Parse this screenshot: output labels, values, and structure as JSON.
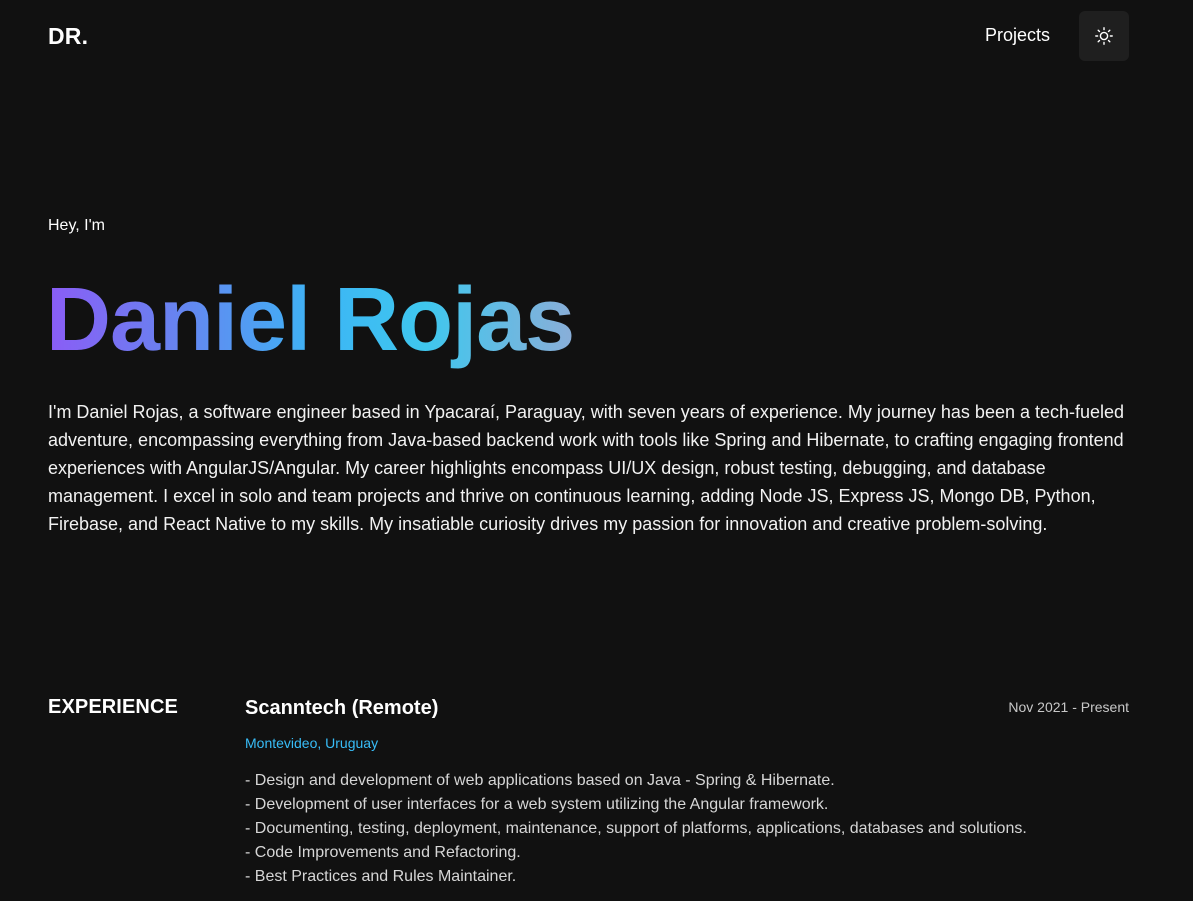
{
  "header": {
    "logo": "DR.",
    "nav_projects": "Projects",
    "theme_toggle_icon": "sun-icon"
  },
  "hero": {
    "greeting": "Hey, I'm",
    "name": "Daniel Rojas",
    "name_gradient": [
      "#8b5cf6",
      "#3cb5f5",
      "#8aaed8"
    ],
    "bio": "I'm Daniel Rojas, a software engineer based in Ypacaraí, Paraguay, with seven years of experience. My journey has been a tech-fueled adventure, encompassing everything from Java-based backend work with tools like Spring and Hibernate, to crafting engaging frontend experiences with AngularJS/Angular. My career highlights encompass UI/UX design, robust testing, debugging, and database management. I excel in solo and team projects and thrive on continuous learning, adding Node JS, Express JS, Mongo DB, Python, Firebase, and React Native to my skills. My insatiable curiosity drives my passion for innovation and creative problem-solving."
  },
  "experience": {
    "heading": "EXPERIENCE",
    "entries": [
      {
        "company": "Scanntech (Remote)",
        "dates": "Nov 2021 - Present",
        "location": "Montevideo, Uruguay",
        "duties": [
          "- Design and development of web applications based on Java - Spring & Hibernate.",
          "- Development of user interfaces for a web system utilizing the Angular framework.",
          "- Documenting, testing, deployment, maintenance, support of platforms, applications, databases and solutions.",
          "- Code Improvements and Refactoring.",
          "- Best Practices and Rules Maintainer."
        ]
      }
    ]
  },
  "colors": {
    "background": "#111111",
    "accent_location": "#38bdf8",
    "toggle_bg": "#1f1f1f"
  }
}
